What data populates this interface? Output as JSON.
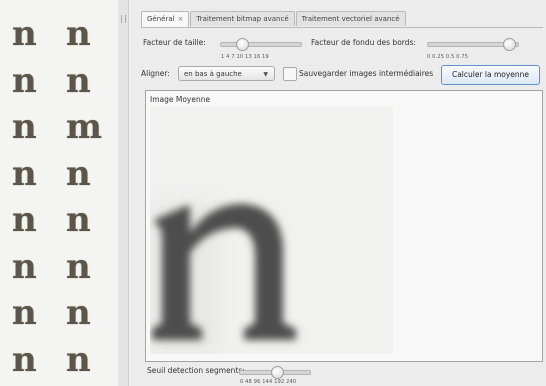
{
  "glyph_rows": [
    {
      "a": "n",
      "b": "n"
    },
    {
      "a": "n",
      "b": "n"
    },
    {
      "a": "n",
      "b": "m"
    },
    {
      "a": "n",
      "b": "n"
    },
    {
      "a": "n",
      "b": "n"
    },
    {
      "a": "n",
      "b": "n"
    },
    {
      "a": "n",
      "b": "n"
    },
    {
      "a": "n",
      "b": "n"
    }
  ],
  "tabs": [
    {
      "label": "Général",
      "close": "×"
    },
    {
      "label": "Traitement bitmap avancé"
    },
    {
      "label": "Traitement vectoriel avancé"
    }
  ],
  "controls": {
    "size_factor_label": "Facteur de taille:",
    "size_ticks": "1  4  7  10  13  16  19",
    "blend_label": "Facteur de fondu des bords:",
    "blend_ticks": "0   0.25  0.5  0.75",
    "align_label": "Aligner:",
    "align_value": "en bas à gauche",
    "save_label": "Sauvegarder images intermédiaires",
    "compute_button": "Calculer la moyenne",
    "segment_label": "Seuil detection segments:",
    "segment_ticks": "0   48   96  144 192 240"
  },
  "image_panel": {
    "title": "Image Moyenne",
    "glyph": "n"
  }
}
